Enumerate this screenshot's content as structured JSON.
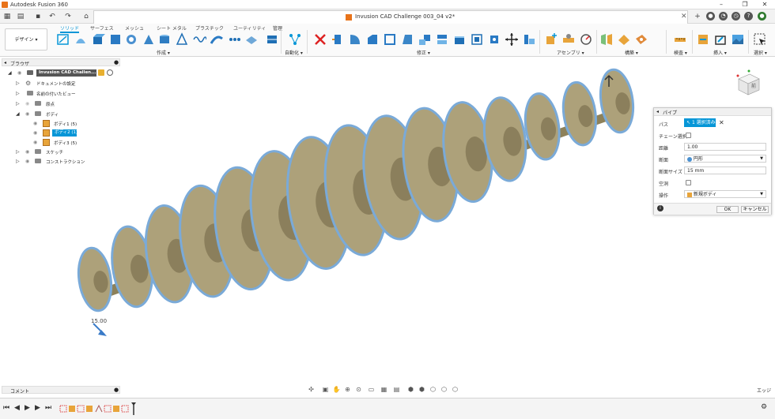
{
  "window": {
    "title": "Autodesk Fusion 360"
  },
  "document": {
    "tab_title": "Invusion CAD Challenge 003_04 v2*"
  },
  "toolbar": {
    "workspace_label": "デザイン ▾",
    "tabs": [
      "ソリッド",
      "サーフェス",
      "メッシュ",
      "シート メタル",
      "プラスチック",
      "ユーティリティ",
      "管理"
    ],
    "groups": [
      "作成 ▾",
      "自動化 ▾",
      "修正 ▾",
      "アセンブリ ▾",
      "構築 ▾",
      "検査 ▾",
      "挿入 ▾",
      "選択 ▾"
    ]
  },
  "browser": {
    "title": "ブラウザ",
    "rows": [
      {
        "label": "Invusion CAD Challen..."
      },
      {
        "label": "ドキュメントの設定"
      },
      {
        "label": "名前の付いたビュー"
      },
      {
        "label": "原点"
      },
      {
        "label": "ボディ"
      },
      {
        "label": "ボディ1 (5)"
      },
      {
        "label": "ボディ2 (1)"
      },
      {
        "label": "ボディ3 (5)"
      },
      {
        "label": "スケッチ"
      },
      {
        "label": "コンストラクション"
      }
    ]
  },
  "viewcube": {
    "face_label": "前"
  },
  "viewport": {
    "dimension_label": "15.00"
  },
  "pipe_dialog": {
    "title": "パイプ",
    "path_label": "パス",
    "path_value": "1 選択済み",
    "chain_label": "チェーン選択",
    "distance_label": "距離",
    "distance_value": "1.00",
    "section_label": "断面",
    "section_value": "円形",
    "section_size_label": "断面サイズ",
    "section_size_value": "15 mm",
    "hollow_label": "空洞",
    "operation_label": "操作",
    "operation_value": "新規ボディ",
    "ok_label": "OK",
    "cancel_label": "キャンセル"
  },
  "comments": {
    "label": "コメント"
  },
  "statusbar": {
    "right_label": "エッジ"
  },
  "colors": {
    "accent": "#0696d7",
    "body": "#ada17a",
    "edge": "#7aaad8"
  }
}
